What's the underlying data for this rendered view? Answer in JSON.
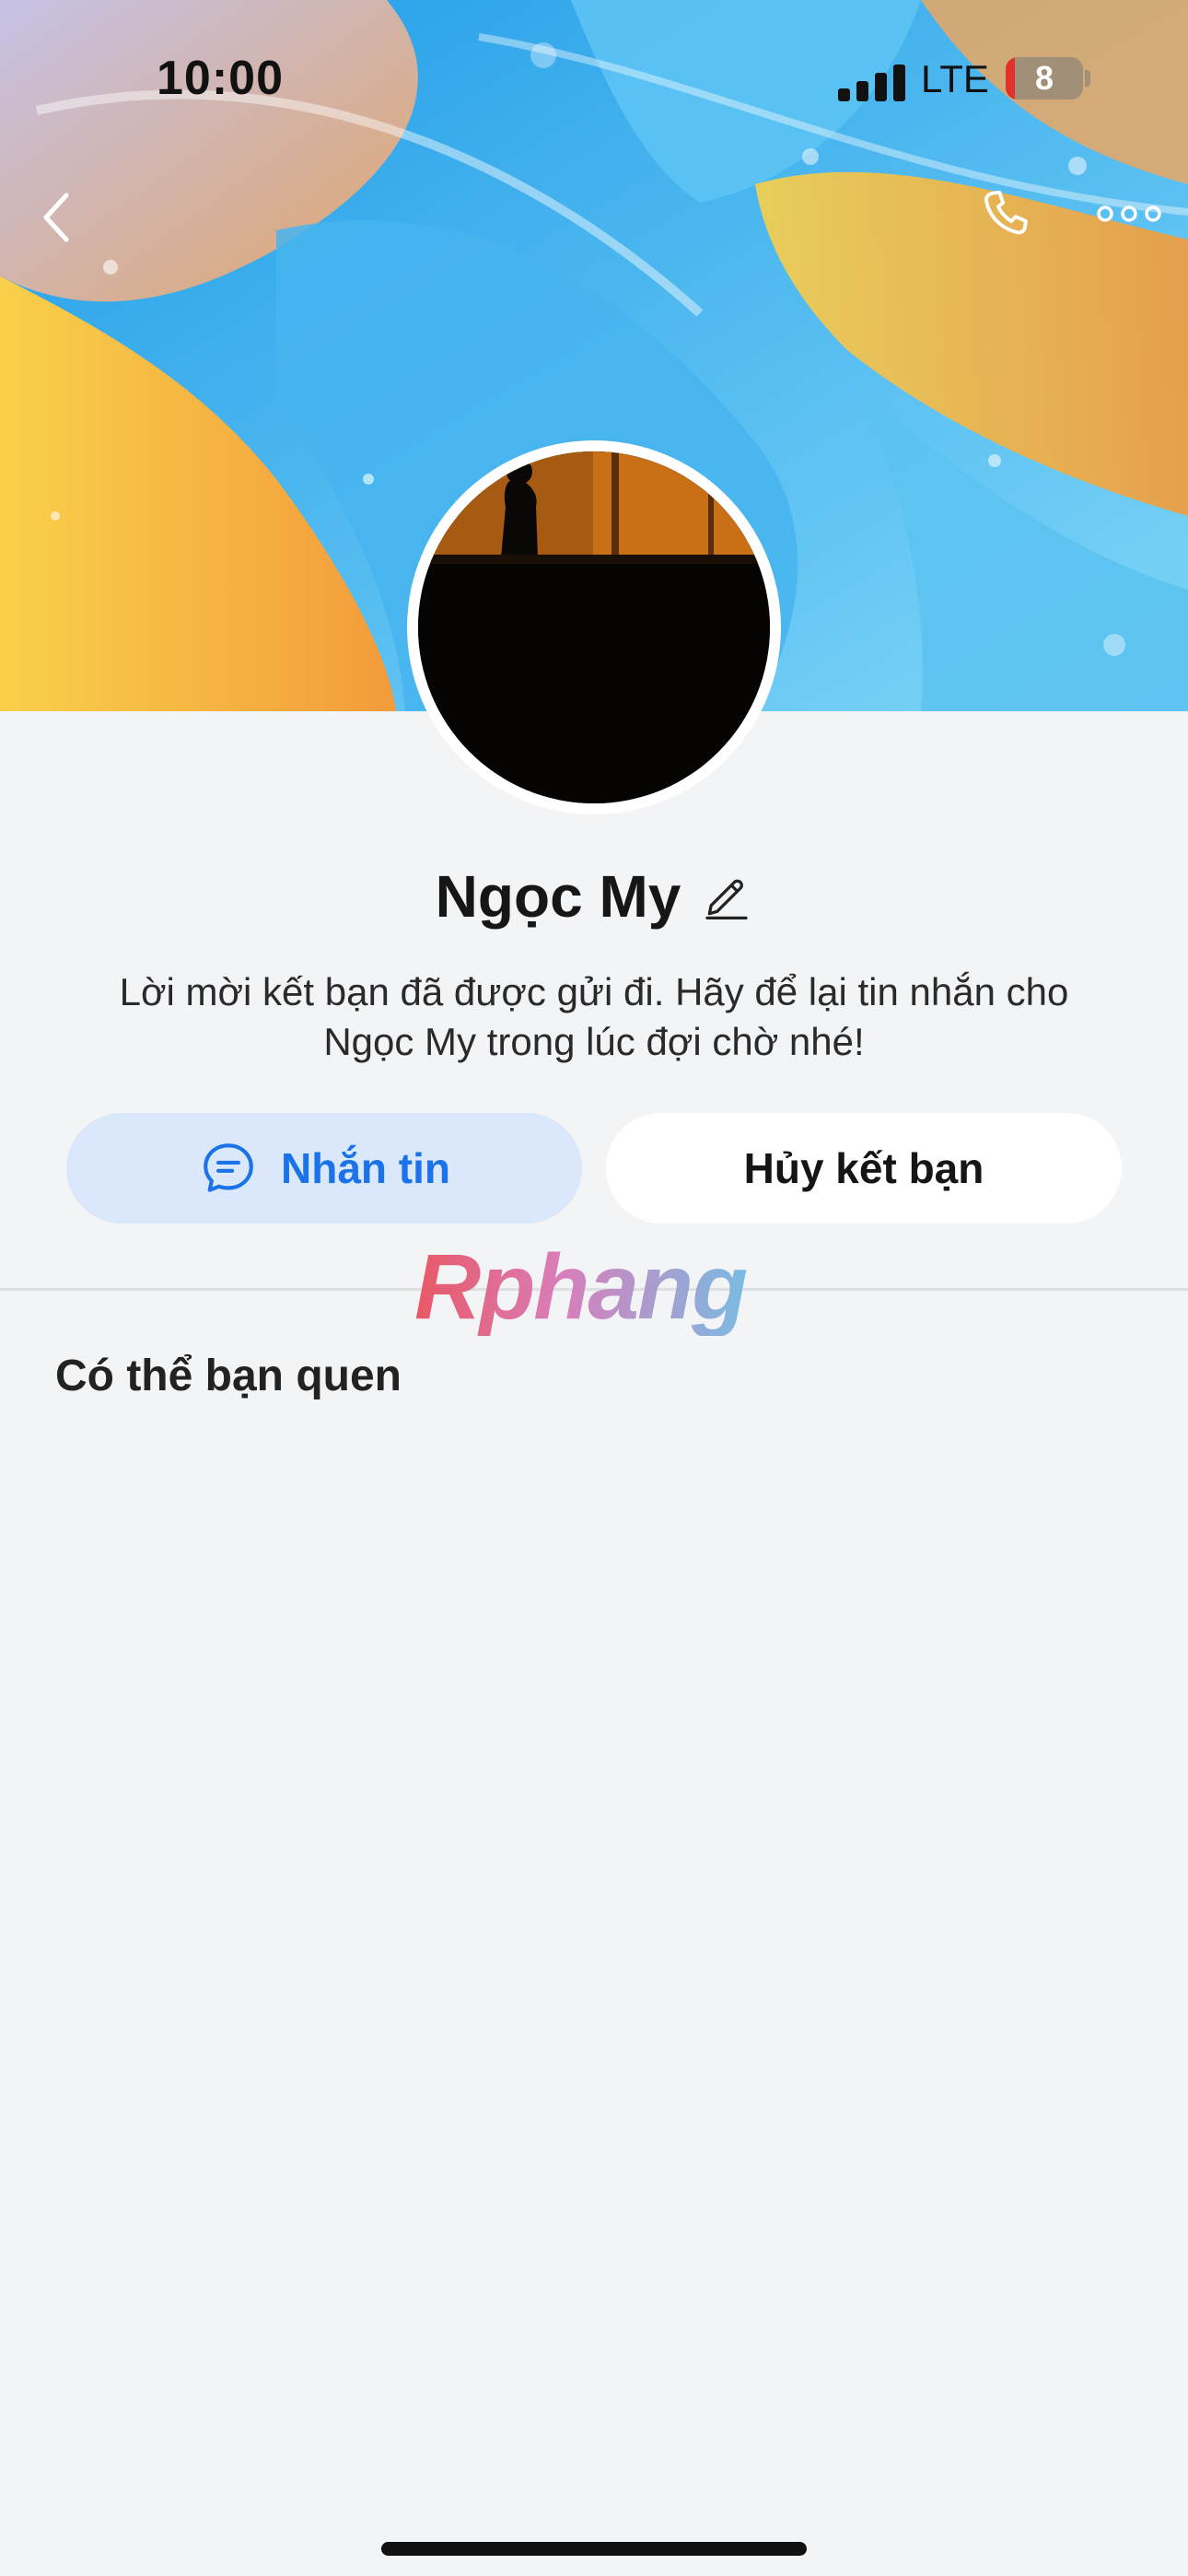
{
  "status_bar": {
    "time": "10:00",
    "network": "LTE",
    "battery_level": "8",
    "battery_color": "#e0312b"
  },
  "header": {
    "back_icon": "chevron-left-icon",
    "call_icon": "phone-icon",
    "more_icon": "more-horizontal-icon"
  },
  "profile": {
    "name": "Ngọc My",
    "edit_icon": "pencil-icon",
    "description": "Lời mời kết bạn đã được gửi đi. Hãy để lại tin nhắn cho Ngọc My trong lúc đợi chờ nhé!"
  },
  "actions": {
    "message_label": "Nhắn tin",
    "message_icon": "chat-bubble-icon",
    "cancel_label": "Hủy kết bạn"
  },
  "watermark": "Rphang",
  "suggestions": {
    "title": "Có thể bạn quen"
  },
  "colors": {
    "accent": "#1a73e8",
    "accent_bg": "#dbe8fb",
    "page_bg": "#f3f4f6"
  }
}
